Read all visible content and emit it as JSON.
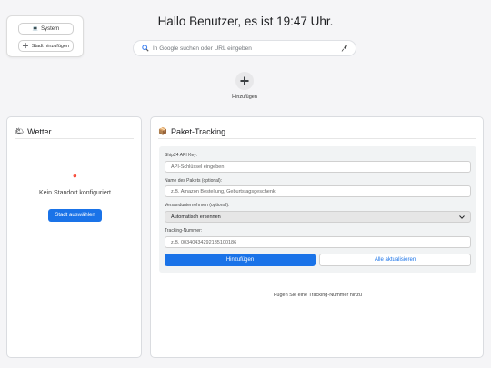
{
  "city_card": {
    "system_label": "System",
    "add_city_label": "Stadt hinzufügen"
  },
  "greeting": "Hallo Benutzer, es ist 19:47 Uhr.",
  "search": {
    "placeholder": "In Google suchen oder URL eingeben"
  },
  "shortcut": {
    "add_label": "Hinzufügen"
  },
  "weather": {
    "title": "Wetter",
    "title_emoji": "🌤",
    "pin_emoji": "📍",
    "message": "Kein Standort konfiguriert",
    "button": "Stadt auswählen"
  },
  "tracking": {
    "title": "Paket-Tracking",
    "title_emoji": "📦",
    "api_key_label": "Ship24 API Key:",
    "api_key_placeholder": "API-Schlüssel eingeben",
    "name_label": "Name des Pakets (optional):",
    "name_placeholder": "z.B. Amazon Bestellung, Geburtstagsgeschenk",
    "carrier_label": "Versandunternehmen (optional):",
    "carrier_value": "Automatisch erkennen",
    "number_label": "Tracking-Nummer:",
    "number_placeholder": "z.B. 00340434292135100186",
    "add_button": "Hinzufügen",
    "refresh_button": "Alle aktualisieren",
    "empty_message": "Fügen Sie eine Tracking-Nummer hinzu"
  },
  "colors": {
    "accent": "#1a73e8",
    "background": "#f5f5f7"
  }
}
